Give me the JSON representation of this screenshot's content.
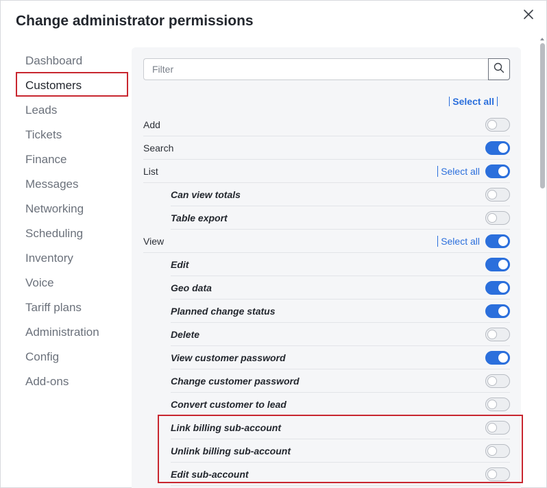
{
  "dialog": {
    "title": "Change administrator permissions",
    "close_icon": "close-icon"
  },
  "nav": {
    "items": [
      {
        "label": "Dashboard",
        "active": false
      },
      {
        "label": "Customers",
        "active": true
      },
      {
        "label": "Leads",
        "active": false
      },
      {
        "label": "Tickets",
        "active": false
      },
      {
        "label": "Finance",
        "active": false
      },
      {
        "label": "Messages",
        "active": false
      },
      {
        "label": "Networking",
        "active": false
      },
      {
        "label": "Scheduling",
        "active": false
      },
      {
        "label": "Inventory",
        "active": false
      },
      {
        "label": "Voice",
        "active": false
      },
      {
        "label": "Tariff plans",
        "active": false
      },
      {
        "label": "Administration",
        "active": false
      },
      {
        "label": "Config",
        "active": false
      },
      {
        "label": "Add-ons",
        "active": false
      }
    ]
  },
  "filter": {
    "placeholder": "Filter",
    "value": "",
    "icon": "search-icon"
  },
  "select_all_top": "Select all",
  "permissions": [
    {
      "label": "Add",
      "sub": false,
      "on": false
    },
    {
      "label": "Search",
      "sub": false,
      "on": true
    },
    {
      "label": "List",
      "sub": false,
      "on": true,
      "select_all": "Select all"
    },
    {
      "label": "Can view totals",
      "sub": true,
      "on": false
    },
    {
      "label": "Table export",
      "sub": true,
      "on": false
    },
    {
      "label": "View",
      "sub": false,
      "on": true,
      "select_all": "Select all"
    },
    {
      "label": "Edit",
      "sub": true,
      "on": true
    },
    {
      "label": "Geo data",
      "sub": true,
      "on": true
    },
    {
      "label": "Planned change status",
      "sub": true,
      "on": true
    },
    {
      "label": "Delete",
      "sub": true,
      "on": false
    },
    {
      "label": "View customer password",
      "sub": true,
      "on": true
    },
    {
      "label": "Change customer password",
      "sub": true,
      "on": false
    },
    {
      "label": "Convert customer to lead",
      "sub": true,
      "on": false
    },
    {
      "label": "Link billing sub-account",
      "sub": true,
      "on": false
    },
    {
      "label": "Unlink billing sub-account",
      "sub": true,
      "on": false
    },
    {
      "label": "Edit sub-account",
      "sub": true,
      "on": false
    }
  ],
  "colors": {
    "accent": "#2b6fdc",
    "highlight": "#c8262f"
  }
}
